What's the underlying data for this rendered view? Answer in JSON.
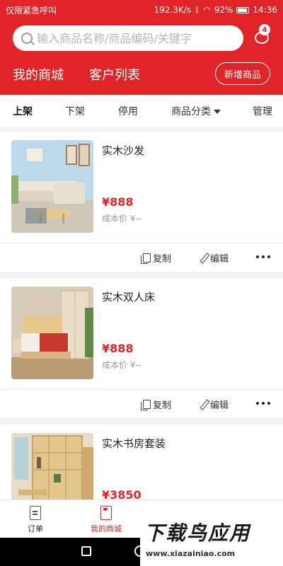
{
  "statusbar": {
    "left_text": "仅限紧急呼叫",
    "speed": "192.3K/s",
    "battery": "92%",
    "time": "14:36"
  },
  "header": {
    "search_placeholder": "输入商品名称/商品编码/关键字",
    "message_badge": "4",
    "tabs": [
      {
        "label": "我的商城"
      },
      {
        "label": "客户列表"
      }
    ],
    "add_button": "新增商品"
  },
  "filters": [
    {
      "label": "上架"
    },
    {
      "label": "下架"
    },
    {
      "label": "停用"
    },
    {
      "label": "商品分类"
    },
    {
      "label": "管理"
    }
  ],
  "products": [
    {
      "name": "实木沙发",
      "price": "¥888",
      "cost": "成本价 ¥--",
      "image": "sofa-image"
    },
    {
      "name": "实木双人床",
      "price": "¥888",
      "cost": "成本价 ¥--",
      "image": "bed-image"
    },
    {
      "name": "实木书房套装",
      "price": "¥3850",
      "cost": "",
      "image": "bookcase-image"
    }
  ],
  "actions": {
    "copy": "复制",
    "edit": "编辑"
  },
  "tabbar": [
    {
      "label": "订单"
    },
    {
      "label": "我的商城"
    }
  ],
  "watermark": {
    "title": "下载鸟应用",
    "url": "www.xiazainiao.com"
  },
  "colors": {
    "brand": "#e02427",
    "background": "#f2f2f2"
  }
}
